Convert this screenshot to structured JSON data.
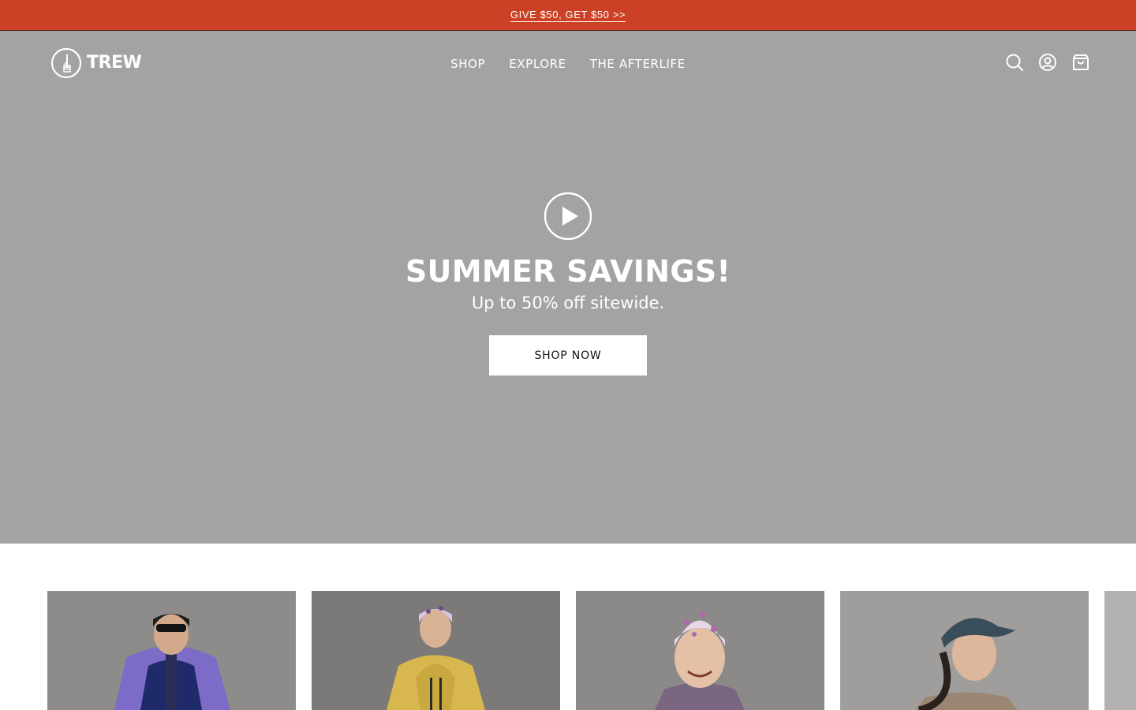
{
  "announcement": {
    "text": "GIVE $50, GET $50 >>",
    "color": "#cc4125"
  },
  "brand": {
    "name": "TREW",
    "logo_icon": "thumbs-up-circle-icon"
  },
  "nav": {
    "items": [
      {
        "label": "SHOP"
      },
      {
        "label": "EXPLORE"
      },
      {
        "label": "THE AFTERLIFE"
      }
    ]
  },
  "header_icons": [
    "search-icon",
    "account-icon",
    "shopping-bag-icon"
  ],
  "hero": {
    "background": "#a3a3a3",
    "play_icon": "play-icon",
    "title": "SUMMER SAVINGS!",
    "subtitle": "Up to 50% off sitewide.",
    "cta_label": "SHOP NOW"
  },
  "product_cards": [
    {
      "image": "man in purple and navy hooded jacket with beanie and sunglasses"
    },
    {
      "image": "woman in yellow shell jacket with patterned headband"
    },
    {
      "image": "smiling child in pink patterned beanie"
    },
    {
      "image": "woman in teal cap looking to the side"
    },
    {
      "image": "partially visible product photo"
    }
  ]
}
